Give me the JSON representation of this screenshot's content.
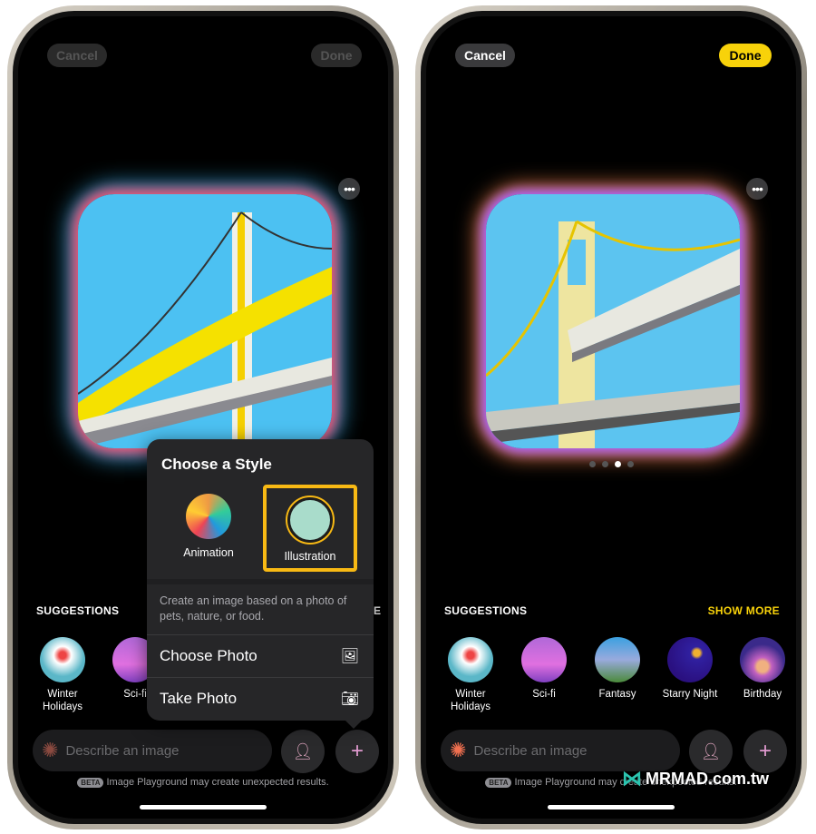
{
  "left_phone": {
    "cancel_label": "Cancel",
    "done_label": "Done",
    "more_icon": "ellipsis-icon",
    "popover": {
      "title": "Choose a Style",
      "styles": [
        {
          "label": "Animation",
          "selected": false
        },
        {
          "label": "Illustration",
          "selected": true
        }
      ],
      "description": "Create an image based on a photo of pets, nature, or food.",
      "choose_photo": "Choose Photo",
      "take_photo": "Take Photo"
    },
    "suggestions_title": "SUGGESTIONS",
    "show_more_partial": "E",
    "suggestions": [
      {
        "label": "Winter Holidays"
      },
      {
        "label": "Sci-fi"
      }
    ],
    "prompt_placeholder": "Describe an image",
    "beta_badge": "BETA",
    "disclaimer": "Image Playground may create unexpected results."
  },
  "right_phone": {
    "cancel_label": "Cancel",
    "done_label": "Done",
    "page_dots": {
      "count": 4,
      "active": 3
    },
    "suggestions_title": "SUGGESTIONS",
    "show_more": "SHOW MORE",
    "suggestions": [
      {
        "label": "Winter Holidays"
      },
      {
        "label": "Sci-fi"
      },
      {
        "label": "Fantasy"
      },
      {
        "label": "Starry Night"
      },
      {
        "label": "Birthday"
      }
    ],
    "prompt_placeholder": "Describe an image",
    "beta_badge": "BETA",
    "disclaimer": "Image Playground may create unexpected results."
  },
  "watermark": "MRMAD.com.tw",
  "colors": {
    "accent_yellow": "#f8d20a",
    "selection_border": "#f8b914",
    "sky": "#5cc4f0"
  }
}
